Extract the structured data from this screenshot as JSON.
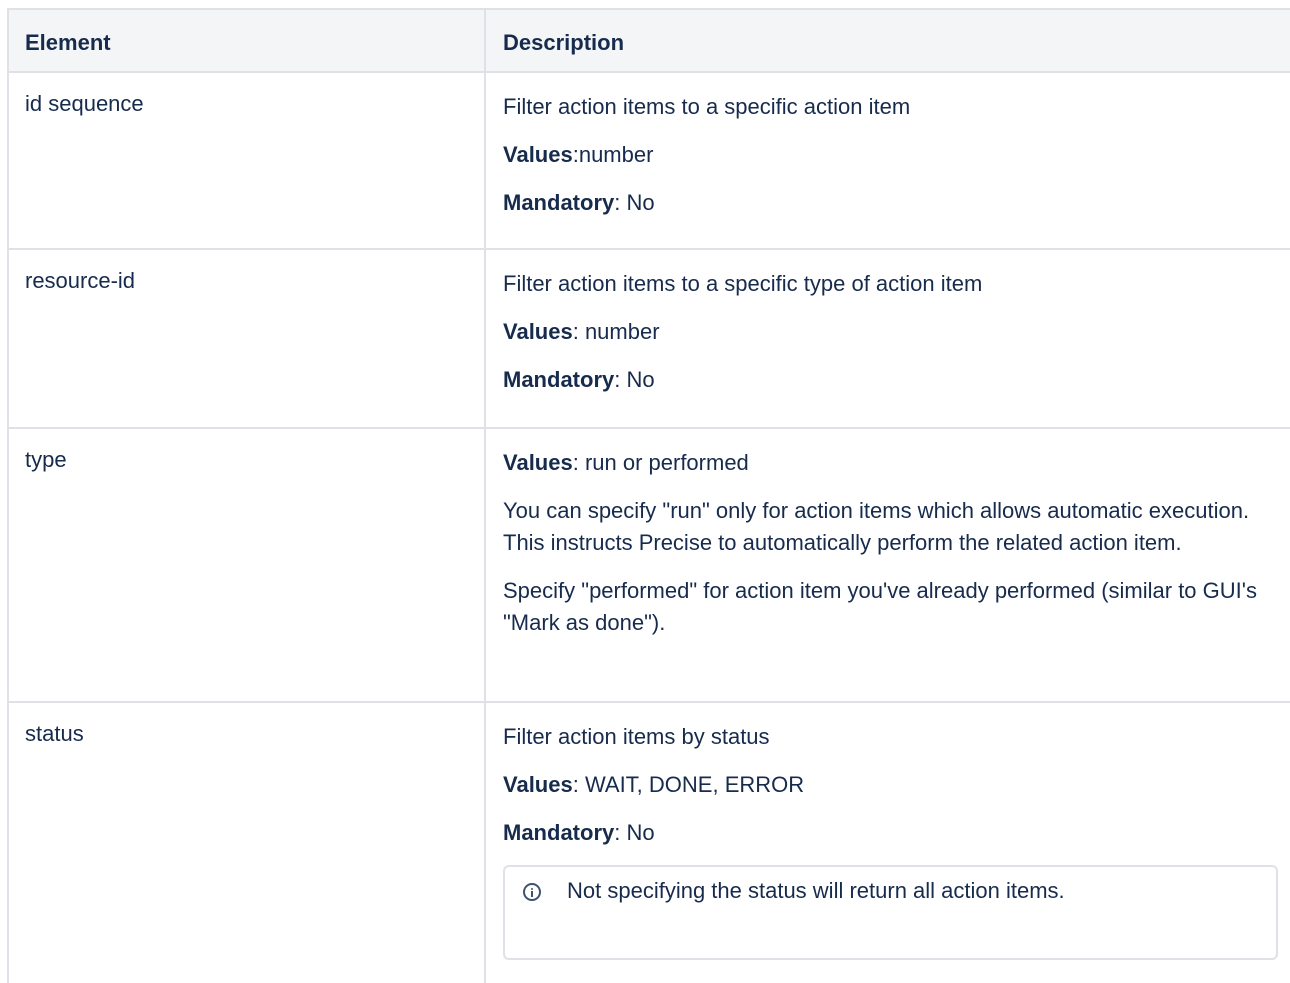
{
  "table": {
    "headers": [
      "Element",
      "Description"
    ],
    "rows": [
      {
        "element": "id sequence",
        "description": "Filter action items to a specific action item",
        "values_key": "Values",
        "values_val": ":number",
        "mandatory_key": "Mandatory",
        "mandatory_val": ": No"
      },
      {
        "element": "resource-id",
        "description": "Filter action items to a specific type of action item",
        "values_key": "Values",
        "values_val": ": number",
        "mandatory_key": "Mandatory",
        "mandatory_val": ": No"
      },
      {
        "element": "type",
        "values_key": "Values",
        "values_val": ": run or performed",
        "para1": "You can specify \"run\" only for action items which allows automatic execution. This instructs Precise to automatically perform the related action item.",
        "para2": "Specify \"performed\" for action item you've already performed (similar to GUI's \"Mark as done\")."
      },
      {
        "element": "status",
        "description": "Filter action items by status",
        "values_key": "Values",
        "values_val": ": WAIT, DONE, ERROR",
        "mandatory_key": "Mandatory",
        "mandatory_val": ": No",
        "info_icon": "info-circle-icon",
        "info_text": "Not specifying the status will return all action items."
      }
    ]
  }
}
